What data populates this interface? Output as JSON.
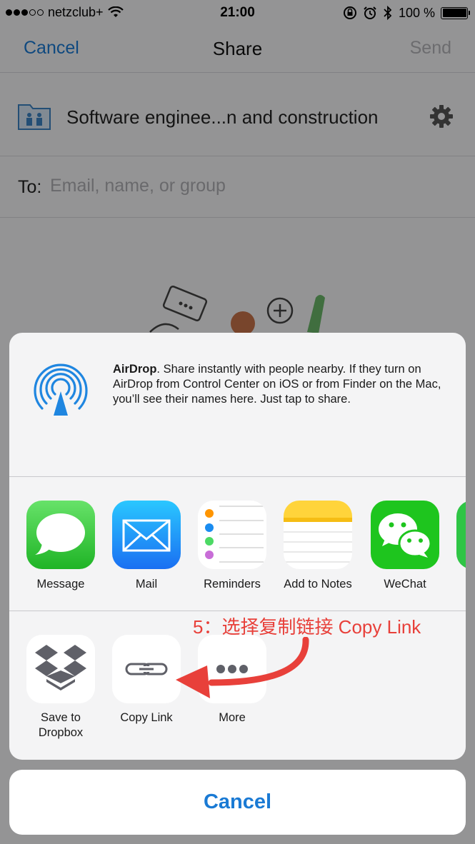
{
  "status_bar": {
    "carrier": "netzclub+",
    "time": "21:00",
    "battery": "100 %"
  },
  "nav": {
    "cancel": "Cancel",
    "title": "Share",
    "send": "Send"
  },
  "folder": {
    "name": "Software enginee...n and construction"
  },
  "recipient": {
    "label": "To:",
    "placeholder": "Email, name, or group"
  },
  "airdrop": {
    "title": "AirDrop",
    "description": ". Share instantly with people nearby. If they turn on AirDrop from Control Center on iOS or from Finder on the Mac, you’ll see their names here. Just tap to share."
  },
  "apps": [
    {
      "label": "Message",
      "icon": "message-icon"
    },
    {
      "label": "Mail",
      "icon": "mail-icon"
    },
    {
      "label": "Reminders",
      "icon": "reminders-icon"
    },
    {
      "label": "Add to Notes",
      "icon": "notes-icon"
    },
    {
      "label": "WeChat",
      "icon": "wechat-icon"
    }
  ],
  "actions": [
    {
      "label": "Save to Dropbox",
      "icon": "dropbox-icon"
    },
    {
      "label": "Copy Link",
      "icon": "link-icon"
    },
    {
      "label": "More",
      "icon": "more-icon"
    }
  ],
  "annotation": "5：选择复制链接 Copy Link",
  "cancel_button": "Cancel",
  "colors": {
    "accent": "#1a7ad4",
    "annotation": "#e8403a"
  }
}
